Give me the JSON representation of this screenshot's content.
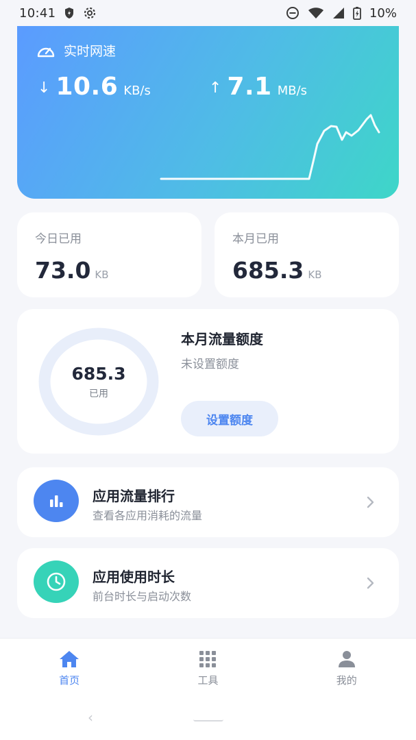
{
  "status_bar": {
    "time": "10:41",
    "battery": "10%"
  },
  "speed": {
    "title": "实时网速",
    "download_value": "10.6",
    "download_unit": "KB/s",
    "upload_value": "7.1",
    "upload_unit": "MB/s"
  },
  "usage": {
    "today_label": "今日已用",
    "today_value": "73.0",
    "today_unit": "KB",
    "month_label": "本月已用",
    "month_value": "685.3",
    "month_unit": "KB"
  },
  "quota": {
    "ring_value": "685.3",
    "ring_label": "已用",
    "title": "本月流量额度",
    "subtitle": "未设置额度",
    "button_label": "设置额度"
  },
  "list": {
    "rank_title": "应用流量排行",
    "rank_subtitle": "查看各应用消耗的流量",
    "duration_title": "应用使用时长",
    "duration_subtitle": "前台时长与启动次数"
  },
  "bottom_nav": {
    "items": [
      {
        "label": "首页",
        "icon": "home-icon",
        "active": true
      },
      {
        "label": "工具",
        "icon": "grid-icon",
        "active": false
      },
      {
        "label": "我的",
        "icon": "person-icon",
        "active": false
      }
    ]
  },
  "colors": {
    "accent": "#4d86f0",
    "teal": "#36d3b8",
    "gradient_start": "#5b9bff",
    "gradient_end": "#3ed6c8"
  }
}
